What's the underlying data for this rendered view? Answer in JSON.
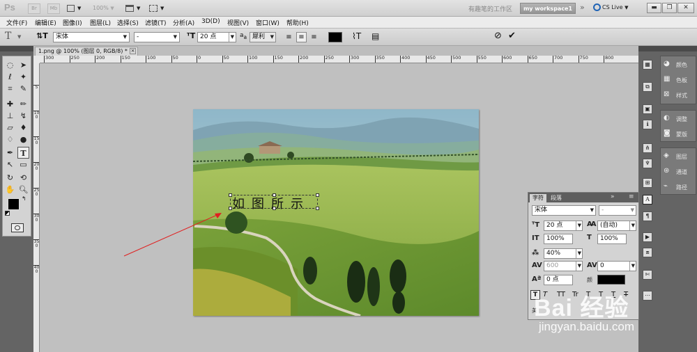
{
  "app": {
    "logo": "Ps",
    "icons": [
      "Br",
      "Mb"
    ],
    "zoom": "100%",
    "workspace_current": "有趣笔的工作区",
    "workspace_button": "my workspace1",
    "cslive": "CS Live"
  },
  "menu": [
    "文件(F)",
    "编辑(E)",
    "图像(I)",
    "图层(L)",
    "选择(S)",
    "滤镜(T)",
    "分析(A)",
    "3D(D)",
    "视图(V)",
    "窗口(W)",
    "帮助(H)"
  ],
  "options": {
    "font_family": "宋体",
    "font_style": "-",
    "font_size": "20 点",
    "aa_label": "a",
    "antialias": "犀利",
    "color": "#000000"
  },
  "document": {
    "tab_title": "1.png @ 100% (图层 0, RGB/8) *",
    "ruler_top": [
      "300",
      "250",
      "200",
      "150",
      "100",
      "50",
      "0",
      "50",
      "100",
      "150",
      "200",
      "250",
      "300",
      "350",
      "400",
      "450",
      "500",
      "550",
      "600",
      "650",
      "700",
      "750",
      "800"
    ],
    "ruler_left": [
      "0",
      "5",
      "100",
      "150",
      "200",
      "250",
      "300",
      "350",
      "400"
    ],
    "text_layer": "如图所示"
  },
  "char_panel": {
    "tabs": [
      "字符",
      "段落"
    ],
    "font_family": "宋体",
    "font_style": "-",
    "size": "20 点",
    "leading": "(自动)",
    "vscale": "100%",
    "hscale": "100%",
    "tsume": "40%",
    "kerning": "600",
    "tracking": "0",
    "baseline": "0 点",
    "color_label": "颜",
    "style_buttons": [
      "T",
      "T",
      "TT",
      "Tr",
      "T",
      "T",
      "T",
      "T"
    ],
    "lang_label": "美"
  },
  "right_panel": {
    "group1": [
      "颜色",
      "色板",
      "样式"
    ],
    "group2": [
      "调整",
      "蒙版"
    ],
    "group3": [
      "图层",
      "通道",
      "路径"
    ]
  },
  "watermark": {
    "logo": "Bai 经验",
    "url": "jingyan.baidu.com"
  },
  "colors": {
    "foreground": "#000000",
    "background": "#ffffff",
    "arrow": "#e02020"
  }
}
